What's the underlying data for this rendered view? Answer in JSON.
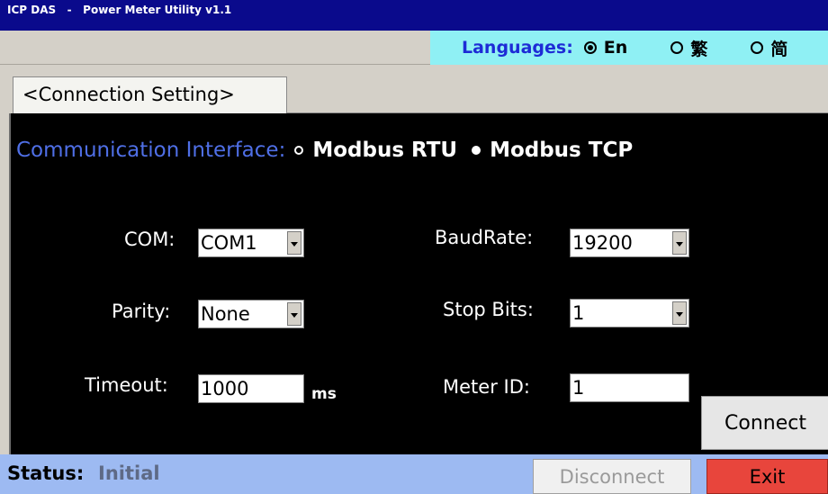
{
  "window": {
    "title": "ICP DAS   -   Power Meter Utility v1.1"
  },
  "languages": {
    "label": "Languages:",
    "options": [
      {
        "label": "En",
        "selected": true
      },
      {
        "label": "繁",
        "selected": false
      },
      {
        "label": "简",
        "selected": false
      }
    ]
  },
  "tabs": [
    {
      "label": "<Connection Setting>",
      "active": true
    }
  ],
  "communication": {
    "label": "Communication Interface:",
    "options": [
      {
        "label": "Modbus RTU",
        "selected": false
      },
      {
        "label": "Modbus TCP",
        "selected": true
      }
    ]
  },
  "fields": {
    "com": {
      "label": "COM:",
      "value": "COM1"
    },
    "baudrate": {
      "label": "BaudRate:",
      "value": "19200"
    },
    "parity": {
      "label": "Parity:",
      "value": "None"
    },
    "stop_bits": {
      "label": "Stop Bits:",
      "value": "1"
    },
    "timeout": {
      "label": "Timeout:",
      "value": "1000",
      "unit": "ms"
    },
    "meter_id": {
      "label": "Meter ID:",
      "value": "1"
    }
  },
  "buttons": {
    "connect": "Connect",
    "disconnect": "Disconnect",
    "exit": "Exit"
  },
  "status": {
    "label": "Status:",
    "value": "Initial"
  },
  "colors": {
    "titlebar": "#0a0a8c",
    "language_panel": "#8ff0f4",
    "language_label": "#1d2bd6",
    "interface_label": "#4f6fe6",
    "statusbar": "#9dbaf2",
    "exit_button": "#e8453c"
  }
}
